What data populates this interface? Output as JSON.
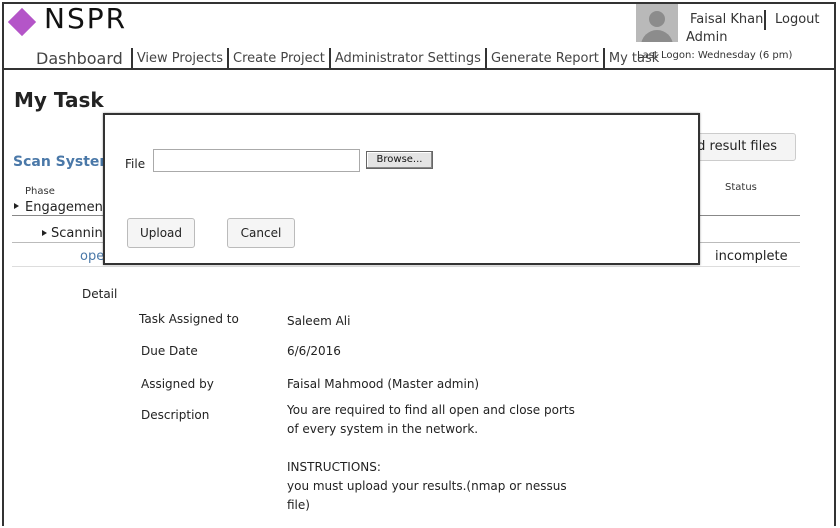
{
  "app": {
    "logo_text": "NSPR",
    "brand_color": "#b455c8",
    "link_color": "#4a78a8"
  },
  "nav": {
    "items": [
      {
        "label": "Dashboard"
      },
      {
        "label": "View Projects"
      },
      {
        "label": "Create Project"
      },
      {
        "label": "Administrator Settings"
      },
      {
        "label": "Generate Report"
      },
      {
        "label": "My task"
      }
    ]
  },
  "user": {
    "name": "Faisal Khan",
    "logout_label": "Logout",
    "role": "Admin",
    "last_logon": "Last Logon:  Wednesday (6 pm)"
  },
  "page": {
    "title": "My Task",
    "section_link": "Scan Systems",
    "upload_button_label": "d result files"
  },
  "table": {
    "col_phase": "Phase",
    "col_status": "Status",
    "phase_value": "Engagement",
    "sub_phase": "Scanning",
    "row_link": "ope",
    "row_status": "incomplete"
  },
  "detail": {
    "label": "Detail",
    "fields": [
      {
        "label": "Task Assigned to",
        "value": "Saleem Ali"
      },
      {
        "label": "Due Date",
        "value": "6/6/2016"
      },
      {
        "label": "Assigned by",
        "value": "Faisal Mahmood (Master admin)"
      },
      {
        "label": "Description",
        "value": ""
      }
    ],
    "description_lines": [
      "You are required to find all open and close ports",
      "of every system in the network.",
      "",
      "INSTRUCTIONS:",
      "you must upload your results.(nmap or nessus",
      "file)"
    ]
  },
  "modal": {
    "file_label": "File",
    "file_value": "",
    "browse_label": "Browse...",
    "upload_label": "Upload",
    "cancel_label": "Cancel"
  }
}
